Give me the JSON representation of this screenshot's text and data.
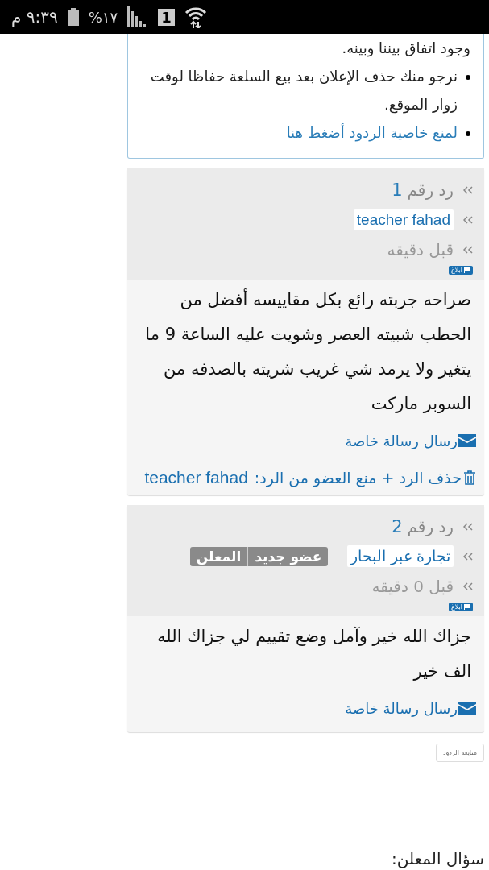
{
  "status_bar": {
    "time": "٩:٣٩ م",
    "battery": "%١٧",
    "sim": "1"
  },
  "notice": {
    "items": [
      {
        "kind": "text",
        "text": "وجود اتفاق بيننا وبينه."
      },
      {
        "kind": "bullet",
        "text": "نرجو منك حذف الإعلان بعد بيع السلعة حفاظا لوقت زوار الموقع."
      },
      {
        "kind": "link",
        "text": "لمنع خاصية الردود أضغط هنا"
      }
    ]
  },
  "replies": [
    {
      "label": "رد رقم",
      "number": "1",
      "author": "teacher fahad",
      "time": "قبل دقيقه",
      "report": "ابلاغ",
      "body": "صراحه جربته رائع بكل مقاييسه أفضل من الحطب شبيته العصر وشويت عليه الساعة 9 ما يتغير ولا يرمد شي غريب شريته بالصدفه من السوبر ماركت",
      "message": "رسال رسالة خاصة",
      "admin": {
        "action": "حذف الرد + منع العضو من الرد:",
        "name": "teacher fahad"
      }
    },
    {
      "label": "رد رقم",
      "number": "2",
      "author": "تجارة عبر البحار",
      "badges": [
        "عضو جديد",
        "المعلن"
      ],
      "time": "قبل 0 دقيقه",
      "report": "ابلاغ",
      "body": "جزاك الله خير وآمل وضع تقييم لي جزاك الله الف خير",
      "message": "رسال رسالة خاصة"
    }
  ],
  "follow_button": "متابعة الردود",
  "question_heading": "سؤال المعلن:"
}
